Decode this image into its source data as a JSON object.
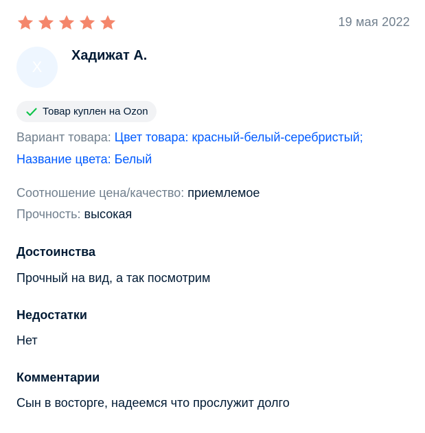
{
  "rating": {
    "stars": 5,
    "max": 5,
    "color": "#f4866b"
  },
  "date": "19 мая 2022",
  "author": {
    "name": "Хадижат А.",
    "avatar_letter": "Х"
  },
  "badge": {
    "icon": "checkmark-icon",
    "label": "Товар куплен на Ozon",
    "icon_color": "#10c44c"
  },
  "variant": {
    "label": "Вариант товара:",
    "color_value": "Цвет товара: красный-белый-серебристый;",
    "name_value": "Название цвета: Белый"
  },
  "attributes": [
    {
      "label": "Соотношение цена/качество:",
      "value": "приемлемое"
    },
    {
      "label": "Прочность:",
      "value": "высокая"
    }
  ],
  "sections": [
    {
      "title": "Достоинства",
      "text": "Прочный на вид, а так посмотрим"
    },
    {
      "title": "Недостатки",
      "text": "Нет"
    },
    {
      "title": "Комментарии",
      "text": "Сын в восторге, надеемся что прослужит долго"
    }
  ]
}
